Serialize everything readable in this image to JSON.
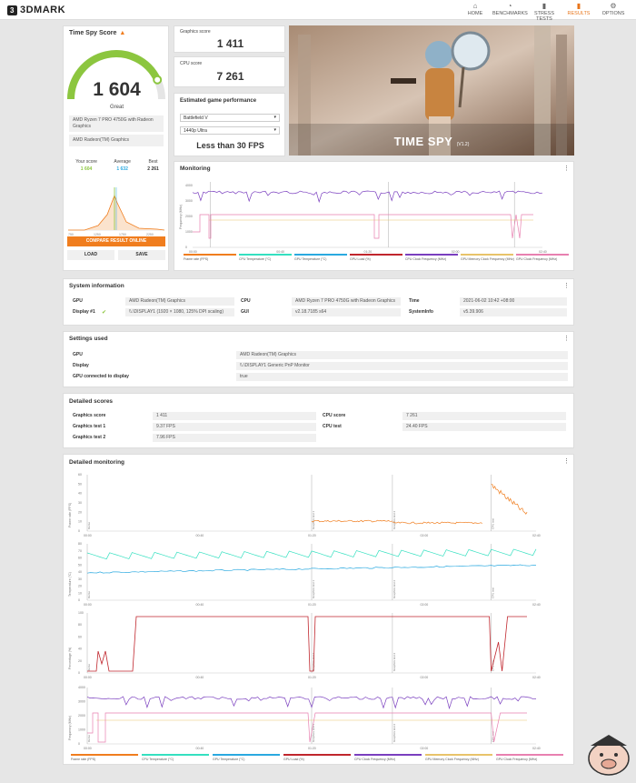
{
  "app": {
    "name": "3DMARK"
  },
  "nav": [
    {
      "label": "HOME",
      "icon": "home-icon",
      "glyph": "⌂"
    },
    {
      "label": "BENCHMARKS",
      "icon": "benchmarks-icon",
      "glyph": "◔"
    },
    {
      "label": "STRESS TESTS",
      "icon": "stress-tests-icon",
      "glyph": "▮"
    },
    {
      "label": "RESULTS",
      "icon": "results-icon",
      "glyph": "▮"
    },
    {
      "label": "OPTIONS",
      "icon": "gear-icon",
      "glyph": "⚙"
    }
  ],
  "score_card": {
    "title": "Time Spy Score",
    "score": "1 604",
    "rating": "Great",
    "cpu_name": "AMD Ryzen 7 PRO 4750G with Radeon Graphics",
    "gpu_name": "AMD Radeon(TM) Graphics",
    "your_score_label": "Your score",
    "average_label": "Average",
    "best_label": "Best",
    "your_score": "1 604",
    "average": "1 632",
    "best": "2 261",
    "compare_button": "COMPARE RESULT ONLINE",
    "load_button": "LOAD",
    "save_button": "SAVE",
    "gauge_fraction": 0.86,
    "accent_green": "#8cc63f",
    "accent_orange": "#f07d1e"
  },
  "graphics_score": {
    "label": "Graphics score",
    "value": "1 411"
  },
  "cpu_score": {
    "label": "CPU score",
    "value": "7 261"
  },
  "game_perf": {
    "title": "Estimated game performance",
    "game": "Battlefield V",
    "preset": "1440p Ultra",
    "result": "Less than 30 FPS"
  },
  "hero": {
    "title": "TIME SPY",
    "version": "(V1.2)"
  },
  "monitoring": {
    "title": "Monitoring",
    "y_label": "Frequency (MHz)",
    "y_ticks": [
      "4000",
      "3000",
      "2000",
      "1000",
      "0"
    ],
    "x_ticks": [
      "00:00",
      "00:40",
      "01:20",
      "02:00",
      "02:40"
    ],
    "legend": [
      {
        "name": "Frame rate (FPS)",
        "color": "#f07d1e"
      },
      {
        "name": "CPU Temperature (°C)",
        "color": "#34e0c0"
      },
      {
        "name": "GPU Temperature (°C)",
        "color": "#2aa9e0"
      },
      {
        "name": "GPU Load (%)",
        "color": "#c0262d"
      },
      {
        "name": "CPU Clock Frequency (MHz)",
        "color": "#7a3fbf"
      },
      {
        "name": "GPU Memory Clock Frequency (MHz)",
        "color": "#e8c36a"
      },
      {
        "name": "GPU Clock Frequency (MHz)",
        "color": "#e880b0"
      }
    ]
  },
  "system_info": {
    "title": "System information",
    "gpu_label": "GPU",
    "gpu_value": "AMD Radeon(TM) Graphics",
    "display_label": "Display #1",
    "display_value": "\\\\.\\DISPLAY1 (1920 × 1080, 125% DPI scaling)",
    "cpu_label": "CPU",
    "cpu_value": "AMD Ryzen 7 PRO 4750G with Radeon Graphics",
    "gui_label": "GUI",
    "gui_value": "v2.18.7185 s64",
    "time_label": "Time",
    "time_value": "2021-06-02 10:42 +08:00",
    "sysinfo_label": "SystemInfo",
    "sysinfo_value": "v5.39.906"
  },
  "settings": {
    "title": "Settings used",
    "rows": [
      {
        "label": "GPU",
        "value": "AMD Radeon(TM) Graphics"
      },
      {
        "label": "Display",
        "value": "\\\\.\\DISPLAY1 Generic PnP Monitor"
      },
      {
        "label": "GPU connected to display",
        "value": "true"
      }
    ]
  },
  "detailed_scores": {
    "title": "Detailed scores",
    "left": [
      {
        "label": "Graphics score",
        "value": "1 411"
      },
      {
        "label": "Graphics test 1",
        "value": "9.37 FPS"
      },
      {
        "label": "Graphics test 2",
        "value": "7.96 FPS"
      }
    ],
    "right": [
      {
        "label": "CPU score",
        "value": "7 261"
      },
      {
        "label": "CPU test",
        "value": "24.40 FPS"
      }
    ]
  },
  "detailed_monitoring": {
    "title": "Detailed monitoring",
    "panels": [
      {
        "y_label": "Frame rate (FPS)",
        "y_ticks": [
          "60",
          "50",
          "40",
          "30",
          "20",
          "10",
          "0"
        ]
      },
      {
        "y_label": "Temperature (°C)",
        "y_ticks": [
          "80",
          "70",
          "60",
          "50",
          "40",
          "30",
          "20",
          "10",
          "0"
        ]
      },
      {
        "y_label": "Percentage (%)",
        "y_ticks": [
          "100",
          "80",
          "60",
          "40",
          "20",
          "0"
        ]
      },
      {
        "y_label": "Frequency (MHz)",
        "y_ticks": [
          "4000",
          "3000",
          "2000",
          "1000",
          "0"
        ]
      }
    ],
    "x_ticks": [
      "00:00",
      "00:40",
      "01:20",
      "02:00",
      "02:40"
    ],
    "markers": [
      "Demo",
      "Graphics test 1",
      "Graphics test 2",
      "CPU test"
    ]
  }
}
